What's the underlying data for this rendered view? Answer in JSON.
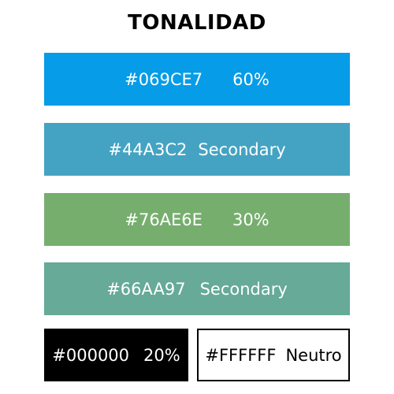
{
  "title": "TONALIDAD",
  "swatches": [
    {
      "hex": "#069CE7",
      "label": "60%",
      "color": "#069CE7",
      "text_color": "#ffffff"
    },
    {
      "hex": "#44A3C2",
      "label": "Secondary",
      "color": "#44A3C2",
      "text_color": "#ffffff"
    },
    {
      "hex": "#76AE6E",
      "label": "30%",
      "color": "#76AE6E",
      "text_color": "#ffffff"
    },
    {
      "hex": "#66AA97",
      "label": "Secondary",
      "color": "#66AA97",
      "text_color": "#ffffff"
    },
    {
      "hex": "#000000",
      "label": "20%",
      "color": "#000000",
      "text_color": "#ffffff"
    },
    {
      "hex": "#FFFFFF",
      "label": "Neutro",
      "color": "#FFFFFF",
      "text_color": "#000000"
    }
  ]
}
